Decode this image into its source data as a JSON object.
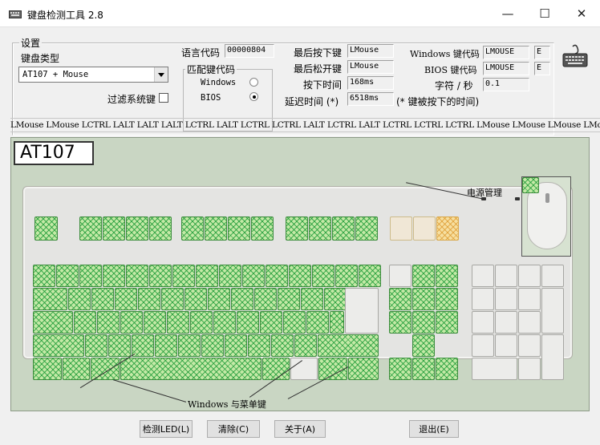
{
  "window": {
    "title": "键盘检测工具 2.8",
    "minimize_glyph": "—",
    "maximize_glyph": "☐",
    "close_glyph": "✕"
  },
  "settings": {
    "group_label": "设置",
    "keyboard_type_label": "键盘类型",
    "keyboard_type_value": "AT107 + Mouse",
    "filter_system_keys_label": "过滤系统键",
    "language_code_label": "语言代码",
    "language_code_value": "00000804",
    "match_keycode_group_label": "匹配键代码",
    "match_windows_label": "Windows",
    "match_bios_label": "BIOS",
    "match_selected": "BIOS"
  },
  "status": {
    "last_pressed_label": "最后按下键",
    "last_pressed_value": "LMouse",
    "last_released_label": "最后松开键",
    "last_released_value": "LMouse",
    "press_time_label": "按下时间",
    "press_time_value": "168ms",
    "delay_time_label": "延迟时间 (*)",
    "delay_time_value": "6518ms",
    "delay_note": "(* 键被按下的时间)",
    "windows_keycode_label": "Windows 键代码",
    "windows_keycode_value": "LMOUSE",
    "windows_keycode_hex": "E",
    "bios_keycode_label": "BIOS 键代码",
    "bios_keycode_value": "LMOUSE",
    "bios_keycode_hex": "E",
    "chars_per_sec_label": "字符 / 秒",
    "chars_per_sec_value": "0.1"
  },
  "log": {
    "entries": [
      "LMouse",
      "LMouse",
      "LCTRL",
      "LALT",
      "LALT",
      "LALT",
      "LCTRL",
      "LALT",
      "LCTRL",
      "LCTRL",
      "LALT",
      "LCTRL",
      "LALT",
      "LCTRL",
      "LCTRL",
      "LCTRL",
      "LMouse",
      "LMouse",
      "LMouse",
      "LMouse"
    ]
  },
  "keyboard": {
    "badge": "AT107",
    "power_caption": "电源管理",
    "windows_menu_caption": "Windows 与菜单键"
  },
  "buttons": {
    "detect_led": "检测LED(L)",
    "clear": "清除(C)",
    "about": "关于(A)",
    "exit": "退出(E)"
  },
  "colors": {
    "pressed_key": "#c4e9a6",
    "pressed_hatch": "#149632",
    "panel_background": "#c9d6c3"
  }
}
